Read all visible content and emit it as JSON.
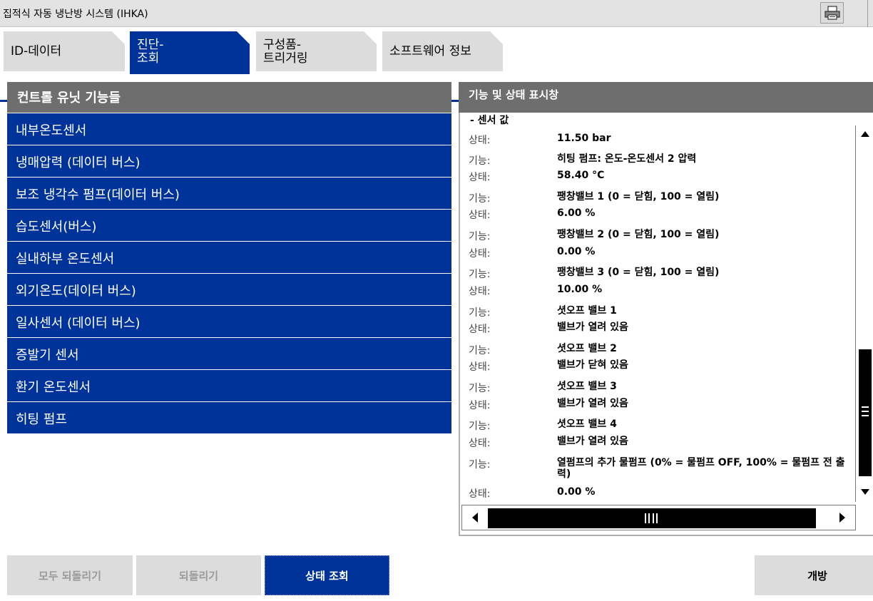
{
  "window": {
    "title": "집적식 자동 냉난방 시스템 (IHKA)"
  },
  "tabs": [
    {
      "line1": "ID-데이터",
      "line2": ""
    },
    {
      "line1": "진단-",
      "line2": "조회"
    },
    {
      "line1": "구성품-",
      "line2": "트리거링"
    },
    {
      "line1": "소프트웨어 정보",
      "line2": ""
    }
  ],
  "left_panel": {
    "header": "컨트롤 유닛 기능들",
    "items": [
      "내부온도센서",
      "냉매압력 (데이터 버스)",
      "보조 냉각수 펌프(데이터 버스)",
      "습도센서(버스)",
      "실내하부 온도센서",
      "외기온도(데이터 버스)",
      "일사센서 (데이터 버스)",
      "증발기 센서",
      "환기 온도센서",
      "히팅 펌프"
    ]
  },
  "right_panel": {
    "header": "기능 및 상태 표시창",
    "section": "- 센서 값",
    "rows": [
      {
        "label": "상태:",
        "value": "11.50  bar"
      },
      {
        "label": "기능:",
        "value": "히팅 펌프: 온도-온도센서 2 압력"
      },
      {
        "label": "상태:",
        "value": "58.40  °C"
      },
      {
        "label": "기능:",
        "value": "팽창밸브 1 (0 = 닫힘, 100 = 열림)"
      },
      {
        "label": "상태:",
        "value": "6.00  %"
      },
      {
        "label": "기능:",
        "value": "팽창밸브 2 (0 = 닫힘, 100 = 열림)"
      },
      {
        "label": "상태:",
        "value": "0.00  %"
      },
      {
        "label": "기능:",
        "value": "팽창밸브 3 (0 = 닫힘, 100 = 열림)"
      },
      {
        "label": "상태:",
        "value": "10.00  %"
      },
      {
        "label": "기능:",
        "value": "셧오프 밸브 1"
      },
      {
        "label": "상태:",
        "value": "밸브가 열려 있음"
      },
      {
        "label": "기능:",
        "value": "셧오프 밸브 2"
      },
      {
        "label": "상태:",
        "value": "밸브가 닫혀 있음"
      },
      {
        "label": "기능:",
        "value": "셧오프 밸브 3"
      },
      {
        "label": "상태:",
        "value": "밸브가 열려 있음"
      },
      {
        "label": "기능:",
        "value": "셧오프 밸브 4"
      },
      {
        "label": "상태:",
        "value": "밸브가 열려 있음"
      },
      {
        "label": "기능:",
        "value": "열펌프의 추가 물펌프 (0% = 물펌프 OFF, 100% = 물펌프 전 출력)"
      },
      {
        "label": "상태:",
        "value": "0.00  %"
      }
    ]
  },
  "buttons": {
    "reset_all": "모두 되돌리기",
    "reset": "되돌리기",
    "query_status": "상태 조회",
    "release": "개방"
  }
}
